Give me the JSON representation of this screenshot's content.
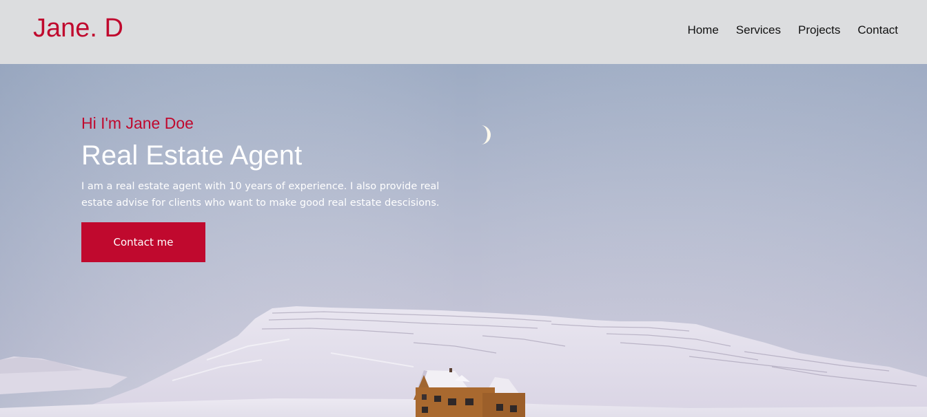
{
  "header": {
    "logo": "Jane. D",
    "nav": [
      {
        "label": "Home"
      },
      {
        "label": "Services"
      },
      {
        "label": "Projects"
      },
      {
        "label": "Contact"
      }
    ]
  },
  "hero": {
    "greeting": "Hi I'm Jane Doe",
    "headline": "Real Estate Agent",
    "description": "I am a real estate agent with 10 years of experience. I also provide real estate advise for clients who want to make good real estate descisions.",
    "cta_label": "Contact me"
  },
  "colors": {
    "accent": "#c0092e",
    "navbar_bg": "#dcdddf"
  }
}
